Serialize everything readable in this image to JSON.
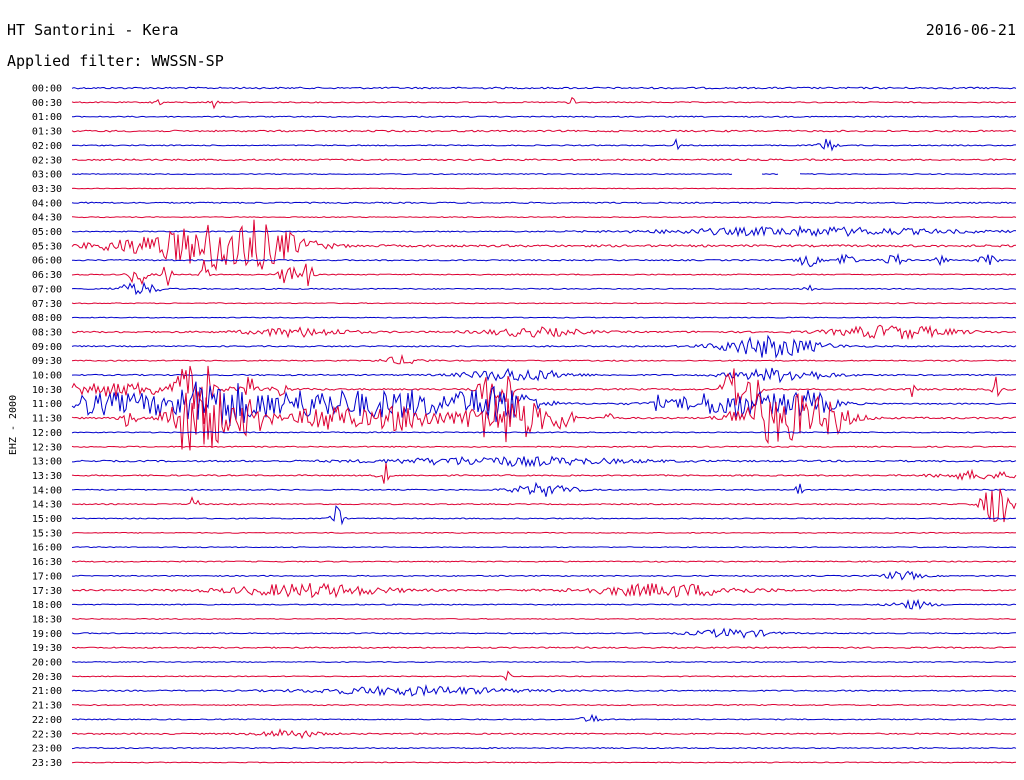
{
  "header": {
    "station": "HT Santorini - Kera",
    "date": "2016-06-21",
    "filter": "Applied filter: WWSSN-SP"
  },
  "chart_data": {
    "type": "line",
    "title": "HT Santorini - Kera",
    "ylabel": "EHZ - 2000",
    "colors": [
      "#0000cc",
      "#dd0033"
    ],
    "rows": [
      {
        "label": "00:00",
        "amp": 1.5
      },
      {
        "label": "00:30",
        "amp": 1.0,
        "events": [
          [
            0.09,
            3,
            0.004
          ],
          [
            0.15,
            3,
            0.004
          ],
          [
            0.53,
            3,
            0.005
          ]
        ]
      },
      {
        "label": "01:00",
        "amp": 1.0
      },
      {
        "label": "01:30",
        "amp": 1.5
      },
      {
        "label": "02:00",
        "amp": 1.0,
        "events": [
          [
            0.64,
            3,
            0.003
          ],
          [
            0.8,
            3,
            0.008
          ]
        ]
      },
      {
        "label": "02:30",
        "amp": 1.5
      },
      {
        "label": "03:00",
        "amp": 0.8,
        "gaps": [
          [
            0.7,
            0.73
          ],
          [
            0.75,
            0.77
          ]
        ]
      },
      {
        "label": "03:30",
        "amp": 0.6
      },
      {
        "label": "04:00",
        "amp": 1.2
      },
      {
        "label": "04:30",
        "amp": 0.8
      },
      {
        "label": "05:00",
        "amp": 1.0,
        "events": [
          [
            0.78,
            2,
            0.15
          ]
        ]
      },
      {
        "label": "05:30",
        "amp": 2.0,
        "events": [
          [
            0.08,
            3,
            0.06
          ],
          [
            0.16,
            9,
            0.06
          ],
          [
            0.2,
            5,
            0.05
          ]
        ]
      },
      {
        "label": "06:00",
        "amp": 1.2,
        "events": [
          [
            0.78,
            3,
            0.01
          ],
          [
            0.82,
            4,
            0.008
          ],
          [
            0.87,
            3,
            0.01
          ],
          [
            0.92,
            4,
            0.005
          ],
          [
            0.97,
            3,
            0.008
          ]
        ]
      },
      {
        "label": "06:30",
        "amp": 1.0,
        "events": [
          [
            0.07,
            6,
            0.008
          ],
          [
            0.1,
            6,
            0.005
          ],
          [
            0.14,
            7,
            0.004
          ],
          [
            0.23,
            5,
            0.01
          ],
          [
            0.25,
            6,
            0.005
          ]
        ]
      },
      {
        "label": "07:00",
        "amp": 1.0,
        "events": [
          [
            0.07,
            3,
            0.02
          ],
          [
            0.78,
            2,
            0.004
          ]
        ]
      },
      {
        "label": "07:30",
        "amp": 0.8
      },
      {
        "label": "08:00",
        "amp": 0.8
      },
      {
        "label": "08:30",
        "amp": 1.5,
        "events": [
          [
            0.24,
            2,
            0.05
          ],
          [
            0.49,
            2,
            0.05
          ],
          [
            0.87,
            3,
            0.06
          ]
        ]
      },
      {
        "label": "09:00",
        "amp": 1.2,
        "events": [
          [
            0.74,
            5,
            0.05
          ]
        ]
      },
      {
        "label": "09:30",
        "amp": 1.0,
        "events": [
          [
            0.35,
            2,
            0.02
          ]
        ]
      },
      {
        "label": "10:00",
        "amp": 1.2,
        "events": [
          [
            0.47,
            3,
            0.05
          ],
          [
            0.75,
            3,
            0.05
          ]
        ]
      },
      {
        "label": "10:30",
        "amp": 1.5,
        "events": [
          [
            0.03,
            3,
            0.12
          ],
          [
            0.12,
            12,
            0.01
          ],
          [
            0.14,
            14,
            0.008
          ],
          [
            0.19,
            8,
            0.005
          ],
          [
            0.22,
            5,
            0.006
          ],
          [
            0.44,
            10,
            0.01
          ],
          [
            0.46,
            8,
            0.008
          ],
          [
            0.7,
            12,
            0.01
          ],
          [
            0.72,
            10,
            0.008
          ],
          [
            0.89,
            4,
            0.003
          ],
          [
            0.98,
            6,
            0.004
          ]
        ]
      },
      {
        "label": "11:00",
        "amp": 1.2,
        "events": [
          [
            0.02,
            5,
            0.15
          ],
          [
            0.15,
            9,
            0.04
          ],
          [
            0.26,
            6,
            0.08
          ],
          [
            0.36,
            5,
            0.05
          ],
          [
            0.45,
            9,
            0.04
          ],
          [
            0.62,
            3,
            0.003
          ],
          [
            0.7,
            6,
            0.06
          ],
          [
            0.78,
            5,
            0.03
          ]
        ]
      },
      {
        "label": "11:30",
        "amp": 1.5,
        "events": [
          [
            0.06,
            4,
            0.008
          ],
          [
            0.12,
            14,
            0.02
          ],
          [
            0.15,
            12,
            0.02
          ],
          [
            0.19,
            8,
            0.02
          ],
          [
            0.27,
            7,
            0.03
          ],
          [
            0.35,
            6,
            0.04
          ],
          [
            0.46,
            12,
            0.04
          ],
          [
            0.52,
            5,
            0.01
          ],
          [
            0.57,
            4,
            0.004
          ],
          [
            0.73,
            9,
            0.03
          ],
          [
            0.78,
            10,
            0.04
          ],
          [
            0.81,
            4,
            0.004
          ]
        ]
      },
      {
        "label": "12:00",
        "amp": 1.0
      },
      {
        "label": "12:30",
        "amp": 1.0
      },
      {
        "label": "13:00",
        "amp": 1.5,
        "events": [
          [
            0.46,
            2,
            0.12
          ]
        ]
      },
      {
        "label": "13:30",
        "amp": 1.2,
        "events": [
          [
            0.33,
            7,
            0.005
          ],
          [
            0.96,
            2,
            0.04
          ]
        ]
      },
      {
        "label": "14:00",
        "amp": 1.0,
        "events": [
          [
            0.5,
            3,
            0.03
          ],
          [
            0.77,
            5,
            0.003
          ]
        ]
      },
      {
        "label": "14:30",
        "amp": 1.0,
        "events": [
          [
            0.13,
            10,
            0.003
          ],
          [
            0.98,
            10,
            0.015
          ]
        ]
      },
      {
        "label": "15:00",
        "amp": 1.0,
        "events": [
          [
            0.28,
            6,
            0.006
          ]
        ]
      },
      {
        "label": "15:30",
        "amp": 0.8
      },
      {
        "label": "16:00",
        "amp": 0.8
      },
      {
        "label": "16:30",
        "amp": 1.0
      },
      {
        "label": "17:00",
        "amp": 1.0,
        "events": [
          [
            0.88,
            2,
            0.02
          ]
        ]
      },
      {
        "label": "17:30",
        "amp": 1.5,
        "events": [
          [
            0.25,
            3,
            0.08
          ],
          [
            0.63,
            3,
            0.08
          ]
        ]
      },
      {
        "label": "18:00",
        "amp": 1.0,
        "events": [
          [
            0.89,
            2,
            0.02
          ]
        ]
      },
      {
        "label": "18:30",
        "amp": 0.8
      },
      {
        "label": "19:00",
        "amp": 1.0,
        "events": [
          [
            0.7,
            2,
            0.04
          ]
        ]
      },
      {
        "label": "19:30",
        "amp": 1.2
      },
      {
        "label": "20:00",
        "amp": 0.8
      },
      {
        "label": "20:30",
        "amp": 0.8,
        "events": [
          [
            0.46,
            5,
            0.003
          ]
        ]
      },
      {
        "label": "21:00",
        "amp": 1.2,
        "events": [
          [
            0.36,
            2,
            0.1
          ]
        ]
      },
      {
        "label": "21:30",
        "amp": 1.0
      },
      {
        "label": "22:00",
        "amp": 1.0,
        "events": [
          [
            0.55,
            2,
            0.01
          ]
        ]
      },
      {
        "label": "22:30",
        "amp": 1.2,
        "events": [
          [
            0.23,
            2,
            0.03
          ]
        ]
      },
      {
        "label": "23:00",
        "amp": 1.0
      },
      {
        "label": "23:30",
        "amp": 0.8
      }
    ]
  }
}
